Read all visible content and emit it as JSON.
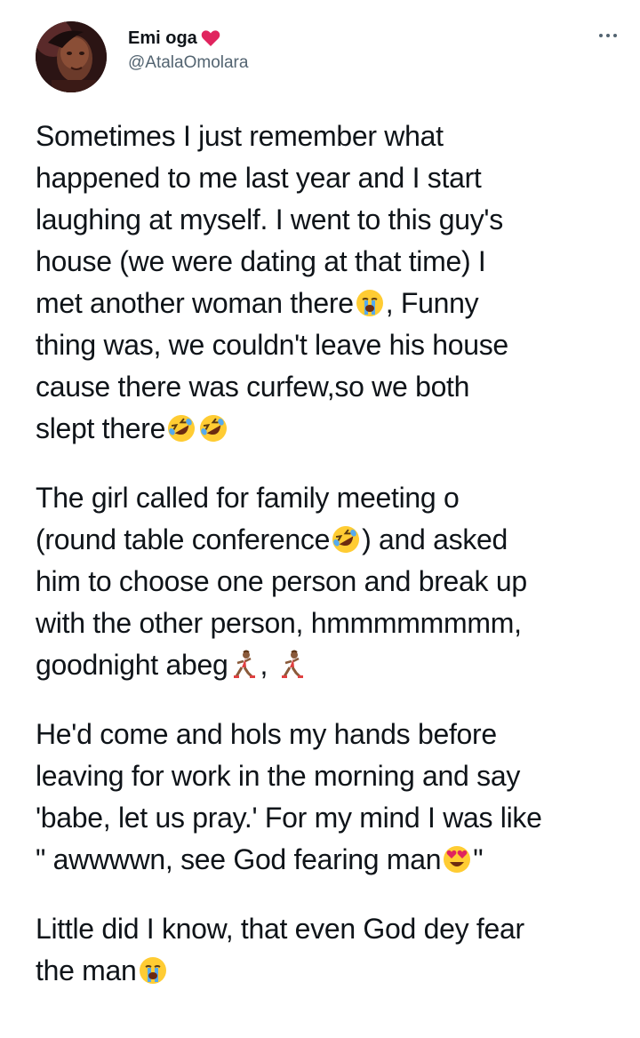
{
  "author": {
    "display_name": "Emi oga",
    "handle": "@AtalaOmolara",
    "name_badge_icon": "red-heart-icon",
    "avatar_icon": "profile-photo"
  },
  "menu": {
    "more_icon": "more-options-icon"
  },
  "tweet": {
    "paragraphs": [
      {
        "lines": [
          "Sometimes I just remember what",
          "happened to me last year and I start",
          "laughing at myself. I went to this guy's",
          "house (we were dating at that time) I",
          {
            "before": "met another woman there",
            "emoji": "loudly-crying-face",
            "after": ", Funny"
          },
          "thing was, we couldn't leave his house",
          "cause there was curfew,so we both",
          {
            "before": "slept there",
            "emoji": "rolling-on-floor-laughing-face",
            "emoji2": "rolling-on-floor-laughing-face",
            "after": ""
          }
        ]
      },
      {
        "lines": [
          "The girl called for family meeting o",
          {
            "before": "(round table conference",
            "emoji": "rolling-on-floor-laughing-face",
            "after": ") and asked"
          },
          "him to choose one person and break up",
          "with the other person, hmmmmmmmm,",
          {
            "before": "goodnight abeg",
            "emoji": "woman-running",
            "after": ", ",
            "emoji2": "woman-running"
          }
        ]
      },
      {
        "lines": [
          "He'd come and hols my hands before",
          "leaving for work in the morning and say",
          "'babe, let us pray.' For my mind I was like",
          {
            "before": "\" awwwwn, see God fearing man",
            "emoji": "smiling-face-with-heart-eyes",
            "after": "\""
          }
        ]
      },
      {
        "lines": [
          "Little did I know, that even God dey fear",
          {
            "before": "the man",
            "emoji": "loudly-crying-face",
            "after": ""
          }
        ]
      }
    ]
  },
  "colors": {
    "text": "#0f1419",
    "secondary": "#536471",
    "heart": "#e0245e"
  }
}
